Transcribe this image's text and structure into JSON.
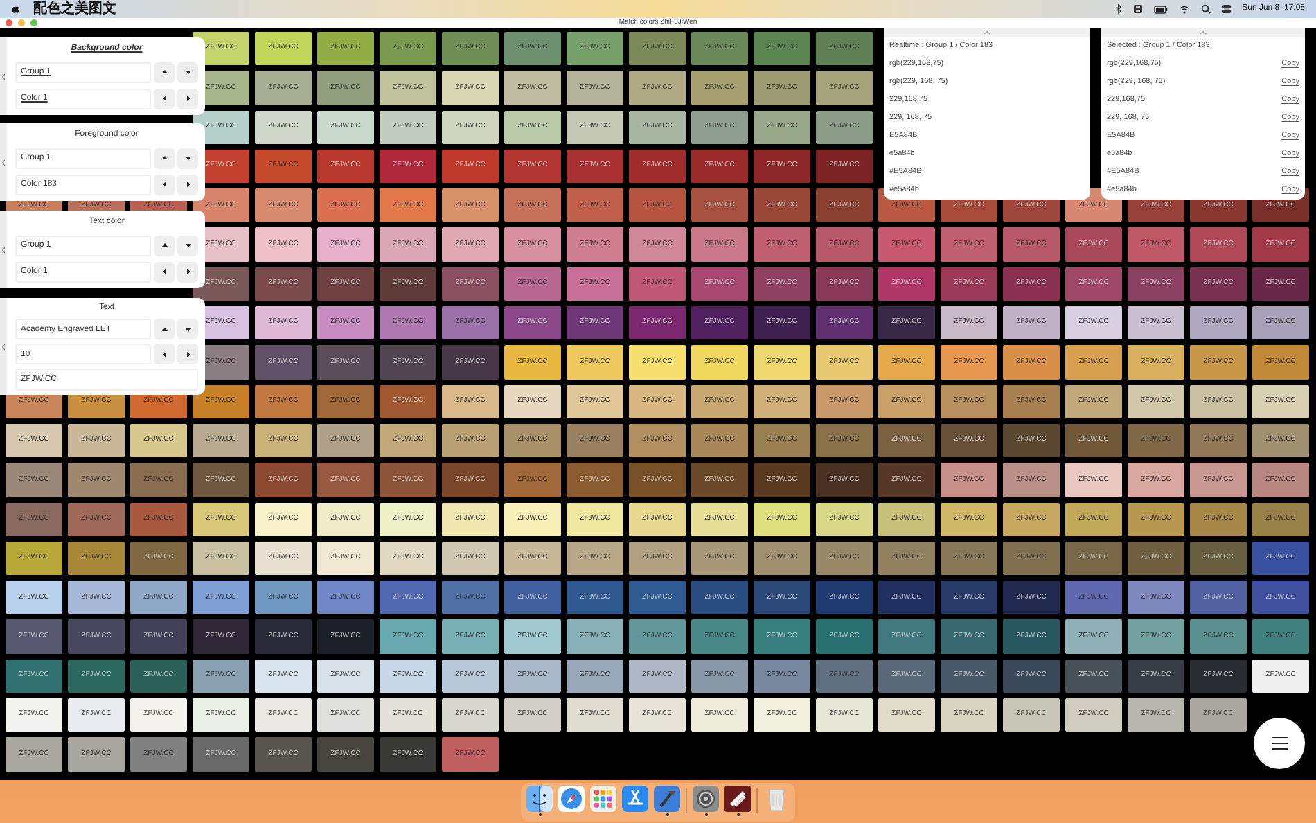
{
  "menu_bar": {
    "app_name": "配色之美图文",
    "clock": "Sun Jun 8  17:08"
  },
  "window": {
    "title": "Match colors ZhiFuJiWen"
  },
  "swatches": [
    {
      "middle": [
        {
          "label": "ZFJW.CC",
          "color": "#c5d46a"
        },
        {
          "label": "ZFJW.CC",
          "color": "#c2d65a"
        },
        {
          "label": "ZFJW.CC",
          "color": "#93ad45"
        },
        {
          "label": "ZFJW.CC",
          "color": "#7a9a50"
        },
        {
          "label": "ZFJW.CC",
          "color": "#6f8f55"
        },
        {
          "label": "ZFJW.CC",
          "color": "#6c8f6e"
        },
        {
          "label": "ZFJW.CC",
          "color": "#78a06a"
        },
        {
          "label": "ZFJW.CC",
          "color": "#7b8a58"
        },
        {
          "label": "ZFJW.CC",
          "color": "#6a8a5a"
        },
        {
          "label": "ZFJW.CC",
          "color": "#5a8550"
        },
        {
          "label": "ZFJW.CC",
          "color": "#5f7f55"
        }
      ]
    },
    {
      "middle": [
        {
          "label": "ZFJW.CC",
          "color": "#a9b58a"
        },
        {
          "label": "ZFJW.CC",
          "color": "#a7ae93"
        },
        {
          "label": "ZFJW.CC",
          "color": "#939e7e"
        },
        {
          "label": "ZFJW.CC",
          "color": "#bfc19a"
        },
        {
          "label": "ZFJW.CC",
          "color": "#d8d6b3"
        },
        {
          "label": "ZFJW.CC",
          "color": "#c0bca0"
        },
        {
          "label": "ZFJW.CC",
          "color": "#b2b39a"
        },
        {
          "label": "ZFJW.CC",
          "color": "#b0aa85"
        },
        {
          "label": "ZFJW.CC",
          "color": "#a8a070"
        },
        {
          "label": "ZFJW.CC",
          "color": "#9b9a70"
        },
        {
          "label": "ZFJW.CC",
          "color": "#a5a37a"
        }
      ]
    },
    {
      "middle": [
        {
          "label": "ZFJW.CC",
          "color": "#b5d0c8"
        },
        {
          "label": "ZFJW.CC",
          "color": "#cfd8c8"
        },
        {
          "label": "ZFJW.CC",
          "color": "#c9d8cc"
        },
        {
          "label": "ZFJW.CC",
          "color": "#c3cdbf"
        },
        {
          "label": "ZFJW.CC",
          "color": "#cfd6bf"
        },
        {
          "label": "ZFJW.CC",
          "color": "#b8c9a8"
        },
        {
          "label": "ZFJW.CC",
          "color": "#c5c8b4"
        },
        {
          "label": "ZFJW.CC",
          "color": "#a8b5a0"
        },
        {
          "label": "ZFJW.CC",
          "color": "#8fa090"
        },
        {
          "label": "ZFJW.CC",
          "color": "#98a88a"
        },
        {
          "label": "ZFJW.CC",
          "color": "#8b9c88"
        }
      ]
    },
    {
      "middle": [
        {
          "label": "ZFJW.CC",
          "color": "#c4402e"
        },
        {
          "label": "ZFJW.CC",
          "color": "#c54a2c"
        },
        {
          "label": "ZFJW.CC",
          "color": "#b8382c"
        },
        {
          "label": "ZFJW.CC",
          "color": "#b0283a"
        },
        {
          "label": "ZFJW.CC",
          "color": "#c0392b"
        },
        {
          "label": "ZFJW.CC",
          "color": "#b2342e"
        },
        {
          "label": "ZFJW.CC",
          "color": "#a83030"
        },
        {
          "label": "ZFJW.CC",
          "color": "#a02c2c"
        },
        {
          "label": "ZFJW.CC",
          "color": "#9b2a2a"
        },
        {
          "label": "ZFJW.CC",
          "color": "#8e2828"
        },
        {
          "label": "ZFJW.CC",
          "color": "#7e2424"
        }
      ]
    },
    {
      "left": [
        {
          "label": "ZFJW.CC",
          "color": "#c58060"
        },
        {
          "label": "ZFJW.CC",
          "color": "#b87058"
        },
        {
          "label": "ZFJW.CC",
          "color": "#b86050"
        }
      ],
      "middle": [
        {
          "label": "ZFJW.CC",
          "color": "#d8836a"
        },
        {
          "label": "ZFJW.CC",
          "color": "#d88a6e"
        },
        {
          "label": "ZFJW.CC",
          "color": "#db7050"
        },
        {
          "label": "ZFJW.CC",
          "color": "#e07848"
        },
        {
          "label": "ZFJW.CC",
          "color": "#d8906a"
        },
        {
          "label": "ZFJW.CC",
          "color": "#c87058"
        },
        {
          "label": "ZFJW.CC",
          "color": "#c06048"
        },
        {
          "label": "ZFJW.CC",
          "color": "#b85540"
        },
        {
          "label": "ZFJW.CC",
          "color": "#a85040"
        },
        {
          "label": "ZFJW.CC",
          "color": "#9a4838"
        },
        {
          "label": "ZFJW.CC",
          "color": "#8c4030"
        }
      ],
      "right": [
        {
          "label": "ZFJW.CC",
          "color": "#b85840"
        },
        {
          "label": "ZFJW.CC",
          "color": "#a84a38"
        },
        {
          "label": "ZFJW.CC",
          "color": "#a0463a"
        },
        {
          "label": "ZFJW.CC",
          "color": "#d88870"
        },
        {
          "label": "ZFJW.CC",
          "color": "#984038"
        },
        {
          "label": "ZFJW.CC",
          "color": "#8a3830"
        },
        {
          "label": "ZFJW.CC",
          "color": "#7a3028"
        }
      ]
    },
    {
      "middle": [
        {
          "label": "ZFJW.CC",
          "color": "#e8c0c8"
        },
        {
          "label": "ZFJW.CC",
          "color": "#f0c0c8"
        },
        {
          "label": "ZFJW.CC",
          "color": "#e8b0c8"
        },
        {
          "label": "ZFJW.CC",
          "color": "#dca8b8"
        },
        {
          "label": "ZFJW.CC",
          "color": "#e0a8b0"
        },
        {
          "label": "ZFJW.CC",
          "color": "#d890a0"
        },
        {
          "label": "ZFJW.CC",
          "color": "#d07f90"
        },
        {
          "label": "ZFJW.CC",
          "color": "#d08898"
        },
        {
          "label": "ZFJW.CC",
          "color": "#c87888"
        },
        {
          "label": "ZFJW.CC",
          "color": "#c06070"
        },
        {
          "label": "ZFJW.CC",
          "color": "#b85868"
        }
      ],
      "right": [
        {
          "label": "ZFJW.CC",
          "color": "#c85870"
        },
        {
          "label": "ZFJW.CC",
          "color": "#c06070"
        },
        {
          "label": "ZFJW.CC",
          "color": "#b85868"
        },
        {
          "label": "ZFJW.CC",
          "color": "#a84858"
        },
        {
          "label": "ZFJW.CC",
          "color": "#c05868"
        },
        {
          "label": "ZFJW.CC",
          "color": "#b04858"
        },
        {
          "label": "ZFJW.CC",
          "color": "#a03848"
        }
      ]
    },
    {
      "middle": [
        {
          "label": "ZFJW.CC",
          "color": "#7a5858"
        },
        {
          "label": "ZFJW.CC",
          "color": "#7a4a4a"
        },
        {
          "label": "ZFJW.CC",
          "color": "#6e4040"
        },
        {
          "label": "ZFJW.CC",
          "color": "#5e3a38"
        },
        {
          "label": "ZFJW.CC",
          "color": "#8a5060"
        },
        {
          "label": "ZFJW.CC",
          "color": "#b86890"
        },
        {
          "label": "ZFJW.CC",
          "color": "#c87098"
        },
        {
          "label": "ZFJW.CC",
          "color": "#c05878"
        },
        {
          "label": "ZFJW.CC",
          "color": "#a84870"
        },
        {
          "label": "ZFJW.CC",
          "color": "#904060"
        },
        {
          "label": "ZFJW.CC",
          "color": "#8a3858"
        }
      ],
      "right": [
        {
          "label": "ZFJW.CC",
          "color": "#b03868"
        },
        {
          "label": "ZFJW.CC",
          "color": "#9a3858"
        },
        {
          "label": "ZFJW.CC",
          "color": "#8a3050"
        },
        {
          "label": "ZFJW.CC",
          "color": "#a04868"
        },
        {
          "label": "ZFJW.CC",
          "color": "#8a4060"
        },
        {
          "label": "ZFJW.CC",
          "color": "#7a3050"
        },
        {
          "label": "ZFJW.CC",
          "color": "#6a2848"
        }
      ]
    },
    {
      "middle": [
        {
          "label": "ZFJW.CC",
          "color": "#d8c0e0"
        },
        {
          "label": "ZFJW.CC",
          "color": "#e0b8d8"
        },
        {
          "label": "ZFJW.CC",
          "color": "#c88cc0"
        },
        {
          "label": "ZFJW.CC",
          "color": "#b078b0"
        },
        {
          "label": "ZFJW.CC",
          "color": "#9a70a8"
        },
        {
          "label": "ZFJW.CC",
          "color": "#8a4888"
        },
        {
          "label": "ZFJW.CC",
          "color": "#703878"
        },
        {
          "label": "ZFJW.CC",
          "color": "#7a2870"
        },
        {
          "label": "ZFJW.CC",
          "color": "#502060"
        },
        {
          "label": "ZFJW.CC",
          "color": "#402050"
        },
        {
          "label": "ZFJW.CC",
          "color": "#603070"
        }
      ],
      "right": [
        {
          "label": "ZFJW.CC",
          "color": "#3a2848"
        },
        {
          "label": "ZFJW.CC",
          "color": "#c8b8c8"
        },
        {
          "label": "ZFJW.CC",
          "color": "#c0b0c8"
        },
        {
          "label": "ZFJW.CC",
          "color": "#d8d0e0"
        },
        {
          "label": "ZFJW.CC",
          "color": "#c8c0d0"
        },
        {
          "label": "ZFJW.CC",
          "color": "#b0a8c0"
        },
        {
          "label": "ZFJW.CC",
          "color": "#a8a0b8"
        }
      ]
    },
    {
      "middle": [
        {
          "label": "ZFJW.CC",
          "color": "#8a7c80"
        },
        {
          "label": "ZFJW.CC",
          "color": "#605068"
        },
        {
          "label": "ZFJW.CC",
          "color": "#5a4c58"
        },
        {
          "label": "ZFJW.CC",
          "color": "#504450"
        },
        {
          "label": "ZFJW.CC",
          "color": "#483848"
        },
        {
          "label": "ZFJW.CC",
          "color": "#e8b840"
        },
        {
          "label": "ZFJW.CC",
          "color": "#f0c860"
        },
        {
          "label": "ZFJW.CC",
          "color": "#f8e070"
        },
        {
          "label": "ZFJW.CC",
          "color": "#f0d860"
        },
        {
          "label": "ZFJW.CC",
          "color": "#f0d870"
        },
        {
          "label": "ZFJW.CC",
          "color": "#e8c870"
        }
      ],
      "right": [
        {
          "label": "ZFJW.CC",
          "color": "#e5a84b"
        },
        {
          "label": "ZFJW.CC",
          "color": "#e89850"
        },
        {
          "label": "ZFJW.CC",
          "color": "#d89048"
        },
        {
          "label": "ZFJW.CC",
          "color": "#d8a050"
        },
        {
          "label": "ZFJW.CC",
          "color": "#d8b060"
        },
        {
          "label": "ZFJW.CC",
          "color": "#c89848"
        },
        {
          "label": "ZFJW.CC",
          "color": "#c08838"
        }
      ]
    },
    {
      "left": [
        {
          "label": "ZFJW.CC",
          "color": "#c8865a"
        },
        {
          "label": "ZFJW.CC",
          "color": "#c89040"
        },
        {
          "label": "ZFJW.CC",
          "color": "#d06830"
        }
      ],
      "middle": [
        {
          "label": "ZFJW.CC",
          "color": "#c88028"
        },
        {
          "label": "ZFJW.CC",
          "color": "#c07840"
        },
        {
          "label": "ZFJW.CC",
          "color": "#a06838"
        },
        {
          "label": "ZFJW.CC",
          "color": "#a05830"
        },
        {
          "label": "ZFJW.CC",
          "color": "#d8b888"
        },
        {
          "label": "ZFJW.CC",
          "color": "#e8d8c0"
        },
        {
          "label": "ZFJW.CC",
          "color": "#e0c898"
        },
        {
          "label": "ZFJW.CC",
          "color": "#d8b880"
        },
        {
          "label": "ZFJW.CC",
          "color": "#c8a870"
        },
        {
          "label": "ZFJW.CC",
          "color": "#d0b078"
        },
        {
          "label": "ZFJW.CC",
          "color": "#c89868"
        }
      ],
      "right": [
        {
          "label": "ZFJW.CC",
          "color": "#c8a068"
        },
        {
          "label": "ZFJW.CC",
          "color": "#b89060"
        },
        {
          "label": "ZFJW.CC",
          "color": "#a88050"
        },
        {
          "label": "ZFJW.CC",
          "color": "#c0a878"
        },
        {
          "label": "ZFJW.CC",
          "color": "#d0c8a8"
        },
        {
          "label": "ZFJW.CC",
          "color": "#c8c0a0"
        },
        {
          "label": "ZFJW.CC",
          "color": "#d8d0b0"
        }
      ]
    },
    {
      "left": [
        {
          "label": "ZFJW.CC",
          "color": "#d8c8b0"
        },
        {
          "label": "ZFJW.CC",
          "color": "#c8b898"
        },
        {
          "label": "ZFJW.CC",
          "color": "#d8c890"
        }
      ],
      "middle": [
        {
          "label": "ZFJW.CC",
          "color": "#b8a890"
        },
        {
          "label": "ZFJW.CC",
          "color": "#c8b078"
        },
        {
          "label": "ZFJW.CC",
          "color": "#b0a088"
        },
        {
          "label": "ZFJW.CC",
          "color": "#c0a878"
        },
        {
          "label": "ZFJW.CC",
          "color": "#b8a070"
        },
        {
          "label": "ZFJW.CC",
          "color": "#a89068"
        },
        {
          "label": "ZFJW.CC",
          "color": "#988060"
        },
        {
          "label": "ZFJW.CC",
          "color": "#b09060"
        },
        {
          "label": "ZFJW.CC",
          "color": "#a88858"
        },
        {
          "label": "ZFJW.CC",
          "color": "#988050"
        },
        {
          "label": "ZFJW.CC",
          "color": "#887048"
        }
      ],
      "right": [
        {
          "label": "ZFJW.CC",
          "color": "#786040"
        },
        {
          "label": "ZFJW.CC",
          "color": "#685038"
        },
        {
          "label": "ZFJW.CC",
          "color": "#5a4830"
        },
        {
          "label": "ZFJW.CC",
          "color": "#705838"
        },
        {
          "label": "ZFJW.CC",
          "color": "#806848"
        },
        {
          "label": "ZFJW.CC",
          "color": "#907858"
        },
        {
          "label": "ZFJW.CC",
          "color": "#a09070"
        }
      ]
    },
    {
      "left": [
        {
          "label": "ZFJW.CC",
          "color": "#9a8878"
        },
        {
          "label": "ZFJW.CC",
          "color": "#a08870"
        },
        {
          "label": "ZFJW.CC",
          "color": "#8a6c50"
        }
      ],
      "middle": [
        {
          "label": "ZFJW.CC",
          "color": "#705840"
        },
        {
          "label": "ZFJW.CC",
          "color": "#8c4a30"
        },
        {
          "label": "ZFJW.CC",
          "color": "#985840"
        },
        {
          "label": "ZFJW.CC",
          "color": "#8c5538"
        },
        {
          "label": "ZFJW.CC",
          "color": "#7a4828"
        },
        {
          "label": "ZFJW.CC",
          "color": "#a06838"
        },
        {
          "label": "ZFJW.CC",
          "color": "#8a5a30"
        },
        {
          "label": "ZFJW.CC",
          "color": "#7a5028"
        },
        {
          "label": "ZFJW.CC",
          "color": "#6a4828"
        },
        {
          "label": "ZFJW.CC",
          "color": "#5a3a20"
        },
        {
          "label": "ZFJW.CC",
          "color": "#4a3020"
        }
      ],
      "right": [
        {
          "label": "ZFJW.CC",
          "color": "#583828"
        },
        {
          "label": "ZFJW.CC",
          "color": "#c89088"
        },
        {
          "label": "ZFJW.CC",
          "color": "#b89088"
        },
        {
          "label": "ZFJW.CC",
          "color": "#e8c8c0"
        },
        {
          "label": "ZFJW.CC",
          "color": "#d8a8a0"
        },
        {
          "label": "ZFJW.CC",
          "color": "#c89890"
        },
        {
          "label": "ZFJW.CC",
          "color": "#b88880"
        }
      ]
    },
    {
      "left": [
        {
          "label": "ZFJW.CC",
          "color": "#8a6a60"
        },
        {
          "label": "ZFJW.CC",
          "color": "#a06858"
        },
        {
          "label": "ZFJW.CC",
          "color": "#a85a40"
        }
      ],
      "middle": [
        {
          "label": "ZFJW.CC",
          "color": "#d8c878"
        },
        {
          "label": "ZFJW.CC",
          "color": "#f8f0c8"
        },
        {
          "label": "ZFJW.CC",
          "color": "#f0ecc8"
        },
        {
          "label": "ZFJW.CC",
          "color": "#eef0c8"
        },
        {
          "label": "ZFJW.CC",
          "color": "#f0e8b0"
        },
        {
          "label": "ZFJW.CC",
          "color": "#f8f0b8"
        },
        {
          "label": "ZFJW.CC",
          "color": "#f0e8a0"
        },
        {
          "label": "ZFJW.CC",
          "color": "#e8d890"
        },
        {
          "label": "ZFJW.CC",
          "color": "#e8e098"
        },
        {
          "label": "ZFJW.CC",
          "color": "#e0e080"
        },
        {
          "label": "ZFJW.CC",
          "color": "#d8d888"
        }
      ],
      "right": [
        {
          "label": "ZFJW.CC",
          "color": "#c8c078"
        },
        {
          "label": "ZFJW.CC",
          "color": "#d0b868"
        },
        {
          "label": "ZFJW.CC",
          "color": "#c8a860"
        },
        {
          "label": "ZFJW.CC",
          "color": "#c0a858"
        },
        {
          "label": "ZFJW.CC",
          "color": "#b89850"
        },
        {
          "label": "ZFJW.CC",
          "color": "#a88848"
        },
        {
          "label": "ZFJW.CC",
          "color": "#988048"
        }
      ]
    },
    {
      "left": [
        {
          "label": "ZFJW.CC",
          "color": "#b8a838"
        },
        {
          "label": "ZFJW.CC",
          "color": "#a88838"
        },
        {
          "label": "ZFJW.CC",
          "color": "#806840"
        }
      ],
      "middle": [
        {
          "label": "ZFJW.CC",
          "color": "#c8c0a0"
        },
        {
          "label": "ZFJW.CC",
          "color": "#e8e0d0"
        },
        {
          "label": "ZFJW.CC",
          "color": "#f0e8d0"
        },
        {
          "label": "ZFJW.CC",
          "color": "#e0d8c0"
        },
        {
          "label": "ZFJW.CC",
          "color": "#d0c8b0"
        },
        {
          "label": "ZFJW.CC",
          "color": "#c8b898"
        },
        {
          "label": "ZFJW.CC",
          "color": "#b8a888"
        },
        {
          "label": "ZFJW.CC",
          "color": "#b0a080"
        },
        {
          "label": "ZFJW.CC",
          "color": "#a89878"
        },
        {
          "label": "ZFJW.CC",
          "color": "#a09070"
        },
        {
          "label": "ZFJW.CC",
          "color": "#988868"
        }
      ],
      "right": [
        {
          "label": "ZFJW.CC",
          "color": "#908060"
        },
        {
          "label": "ZFJW.CC",
          "color": "#887858"
        },
        {
          "label": "ZFJW.CC",
          "color": "#807050"
        },
        {
          "label": "ZFJW.CC",
          "color": "#786848"
        },
        {
          "label": "ZFJW.CC",
          "color": "#706040"
        },
        {
          "label": "ZFJW.CC",
          "color": "#686040"
        },
        {
          "label": "ZFJW.CC",
          "color": "#3a50a0"
        }
      ]
    },
    {
      "left": [
        {
          "label": "ZFJW.CC",
          "color": "#b8d0ec"
        },
        {
          "label": "ZFJW.CC",
          "color": "#a8b8d8"
        },
        {
          "label": "ZFJW.CC",
          "color": "#90a8c8"
        }
      ],
      "middle": [
        {
          "label": "ZFJW.CC",
          "color": "#80a0d8"
        },
        {
          "label": "ZFJW.CC",
          "color": "#7098c0"
        },
        {
          "label": "ZFJW.CC",
          "color": "#7088c8"
        },
        {
          "label": "ZFJW.CC",
          "color": "#5068b0"
        },
        {
          "label": "ZFJW.CC",
          "color": "#5070a8"
        },
        {
          "label": "ZFJW.CC",
          "color": "#4060a0"
        },
        {
          "label": "ZFJW.CC",
          "color": "#305890"
        },
        {
          "label": "ZFJW.CC",
          "color": "#2f5a92"
        },
        {
          "label": "ZFJW.CC",
          "color": "#284c80"
        },
        {
          "label": "ZFJW.CC",
          "color": "#2a4878"
        },
        {
          "label": "ZFJW.CC",
          "color": "#1e3a70"
        }
      ],
      "right": [
        {
          "label": "ZFJW.CC",
          "color": "#203060"
        },
        {
          "label": "ZFJW.CC",
          "color": "#283a68"
        },
        {
          "label": "ZFJW.CC",
          "color": "#202850"
        },
        {
          "label": "ZFJW.CC",
          "color": "#6068b0"
        },
        {
          "label": "ZFJW.CC",
          "color": "#8088c0"
        },
        {
          "label": "ZFJW.CC",
          "color": "#5060a0"
        },
        {
          "label": "ZFJW.CC",
          "color": "#4050a0"
        }
      ]
    },
    {
      "left": [
        {
          "label": "ZFJW.CC",
          "color": "#585870"
        },
        {
          "label": "ZFJW.CC",
          "color": "#484860"
        },
        {
          "label": "ZFJW.CC",
          "color": "#404058"
        }
      ],
      "middle": [
        {
          "label": "ZFJW.CC",
          "color": "#302838"
        },
        {
          "label": "ZFJW.CC",
          "color": "#282838"
        },
        {
          "label": "ZFJW.CC",
          "color": "#1c2028"
        },
        {
          "label": "ZFJW.CC",
          "color": "#68a8b0"
        },
        {
          "label": "ZFJW.CC",
          "color": "#78b0b8"
        },
        {
          "label": "ZFJW.CC",
          "color": "#a0c8d0"
        },
        {
          "label": "ZFJW.CC",
          "color": "#88b0b8"
        },
        {
          "label": "ZFJW.CC",
          "color": "#60989c"
        },
        {
          "label": "ZFJW.CC",
          "color": "#488888"
        },
        {
          "label": "ZFJW.CC",
          "color": "#388080"
        },
        {
          "label": "ZFJW.CC",
          "color": "#287070"
        }
      ],
      "right": [
        {
          "label": "ZFJW.CC",
          "color": "#407880"
        },
        {
          "label": "ZFJW.CC",
          "color": "#386870"
        },
        {
          "label": "ZFJW.CC",
          "color": "#285860"
        },
        {
          "label": "ZFJW.CC",
          "color": "#90b0b8"
        },
        {
          "label": "ZFJW.CC",
          "color": "#70a0a0"
        },
        {
          "label": "ZFJW.CC",
          "color": "#5a9090"
        },
        {
          "label": "ZFJW.CC",
          "color": "#408080"
        }
      ]
    },
    {
      "left": [
        {
          "label": "ZFJW.CC",
          "color": "#307070"
        },
        {
          "label": "ZFJW.CC",
          "color": "#2a6860"
        },
        {
          "label": "ZFJW.CC",
          "color": "#2a6058"
        }
      ],
      "middle": [
        {
          "label": "ZFJW.CC",
          "color": "#88a0b0"
        },
        {
          "label": "ZFJW.CC",
          "color": "#d8e4f0"
        },
        {
          "label": "ZFJW.CC",
          "color": "#d8e0e8"
        },
        {
          "label": "ZFJW.CC",
          "color": "#c8d8e8"
        },
        {
          "label": "ZFJW.CC",
          "color": "#b8c8d8"
        },
        {
          "label": "ZFJW.CC",
          "color": "#a8b8c8"
        },
        {
          "label": "ZFJW.CC",
          "color": "#98a8b8"
        },
        {
          "label": "ZFJW.CC",
          "color": "#b0b8c8"
        },
        {
          "label": "ZFJW.CC",
          "color": "#8898a8"
        },
        {
          "label": "ZFJW.CC",
          "color": "#7888a0"
        },
        {
          "label": "ZFJW.CC",
          "color": "#607080"
        }
      ],
      "right": [
        {
          "label": "ZFJW.CC",
          "color": "#586878"
        },
        {
          "label": "ZFJW.CC",
          "color": "#485868"
        },
        {
          "label": "ZFJW.CC",
          "color": "#384858"
        },
        {
          "label": "ZFJW.CC",
          "color": "#485058"
        },
        {
          "label": "ZFJW.CC",
          "color": "#383c44"
        },
        {
          "label": "ZFJW.CC",
          "color": "#282c30"
        },
        {
          "label": "ZFJW.CC",
          "color": "#f0f0f0"
        }
      ]
    },
    {
      "left": [
        {
          "label": "ZFJW.CC",
          "color": "#f2f2f0"
        },
        {
          "label": "ZFJW.CC",
          "color": "#e8ecf0"
        },
        {
          "label": "ZFJW.CC",
          "color": "#f4f2ec"
        }
      ],
      "middle": [
        {
          "label": "ZFJW.CC",
          "color": "#eceee8"
        },
        {
          "label": "ZFJW.CC",
          "color": "#ebe8e4"
        },
        {
          "label": "ZFJW.CC",
          "color": "#e0e0dc"
        },
        {
          "label": "ZFJW.CC",
          "color": "#e4e2d8"
        },
        {
          "label": "ZFJW.CC",
          "color": "#d8d8d0"
        },
        {
          "label": "ZFJW.CC",
          "color": "#d0d0c8"
        },
        {
          "label": "ZFJW.CC",
          "color": "#e0dcd0"
        },
        {
          "label": "ZFJW.CC",
          "color": "#e8e4d8"
        },
        {
          "label": "ZFJW.CC",
          "color": "#f0ecdc"
        },
        {
          "label": "ZFJW.CC",
          "color": "#f4f0e0"
        },
        {
          "label": "ZFJW.CC",
          "color": "#e8e8d8"
        }
      ],
      "right": [
        {
          "label": "ZFJW.CC",
          "color": "#e0dcc8"
        },
        {
          "label": "ZFJW.CC",
          "color": "#d8d4c0"
        },
        {
          "label": "ZFJW.CC",
          "color": "#c8c8b8"
        },
        {
          "label": "ZFJW.CC",
          "color": "#d0ccc0"
        },
        {
          "label": "ZFJW.CC",
          "color": "#b8b8b0"
        },
        {
          "label": "ZFJW.CC",
          "color": "#a8a8a0"
        }
      ]
    },
    {
      "left": [
        {
          "label": "ZFJW.CC",
          "color": "#a8a8a0"
        },
        {
          "label": "ZFJW.CC",
          "color": "#a8a4a0"
        },
        {
          "label": "ZFJW.CC",
          "color": "#808080"
        }
      ],
      "middle": [
        {
          "label": "ZFJW.CC",
          "color": "#686868"
        },
        {
          "label": "ZFJW.CC",
          "color": "#585450"
        },
        {
          "label": "ZFJW.CC",
          "color": "#484440"
        },
        {
          "label": "ZFJW.CC",
          "color": "#383834"
        },
        {
          "label": "ZFJW.CC",
          "color": "#c06060"
        }
      ]
    }
  ],
  "side_panels": [
    {
      "title": "Background color",
      "active": true,
      "fields": [
        "Group 1",
        "Color 1"
      ]
    },
    {
      "title": "Foreground color",
      "active": false,
      "fields": [
        "Group 1",
        "Color 183"
      ]
    },
    {
      "title": "Text color",
      "active": false,
      "fields": [
        "Group 1",
        "Color 1"
      ]
    },
    {
      "title": "Text",
      "active": false,
      "fields": [
        "Academy Engraved LET",
        "10"
      ],
      "text_value": "ZFJW.CC"
    }
  ],
  "realtime_panel": {
    "title": "Realtime : Group 1 / Color 183",
    "values": [
      "rgb(229,168,75)",
      "rgb(229, 168, 75)",
      "229,168,75",
      "229, 168, 75",
      "E5A84B",
      "e5a84b",
      "#E5A84B",
      "#e5a84b"
    ]
  },
  "selected_panel": {
    "title": "Selected : Group 1 / Color 183",
    "values": [
      {
        "value": "rgb(229,168,75)",
        "action": "Copy"
      },
      {
        "value": "rgb(229, 168, 75)",
        "action": "Copy"
      },
      {
        "value": "229,168,75",
        "action": "Copy"
      },
      {
        "value": "229, 168, 75",
        "action": "Copy"
      },
      {
        "value": "E5A84B",
        "action": "Copy"
      },
      {
        "value": "e5a84b",
        "action": "Copy"
      },
      {
        "value": "#E5A84B",
        "action": "Copy"
      },
      {
        "value": "#e5a84b",
        "action": "Copy"
      }
    ]
  },
  "dock": [
    {
      "kind": "finder",
      "running": true
    },
    {
      "kind": "safari",
      "running": false
    },
    {
      "kind": "launchpad",
      "running": false
    },
    {
      "kind": "appstore",
      "running": false
    },
    {
      "kind": "xcode",
      "running": true
    },
    {
      "kind": "separator"
    },
    {
      "kind": "settings",
      "running": true
    },
    {
      "kind": "colorapp",
      "running": true
    },
    {
      "kind": "separator"
    },
    {
      "kind": "trash",
      "running": false
    }
  ]
}
